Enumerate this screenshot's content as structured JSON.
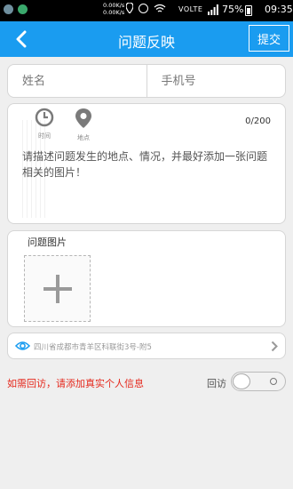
{
  "status_bar": {
    "net_speed_up": "0.00K/s",
    "net_speed_down": "0.00K/s",
    "carrier": "VOLTE",
    "battery": "75%",
    "time": "09:35",
    "icons": [
      "sim-icon",
      "app-icon",
      "location-icon",
      "alarm-icon",
      "wifi-icon",
      "signal-icon",
      "battery-icon"
    ]
  },
  "header": {
    "title": "问题反映",
    "submit_label": "提交",
    "color": "#1a9cf0"
  },
  "form": {
    "name_placeholder": "姓名",
    "phone_placeholder": "手机号",
    "tools": [
      {
        "label": "时间",
        "icon": "clock-icon"
      },
      {
        "label": "地点",
        "icon": "location-pin-icon"
      }
    ],
    "counter": "0/200",
    "description_placeholder": "请描述问题发生的地点、情况，并最好添加一张问题相关的图片！",
    "photos_title": "问题图片",
    "address": "四川省成都市青羊区科联街3号-附5"
  },
  "footer": {
    "hint": "如需回访，请添加真实个人信息",
    "revisit_label": "回访",
    "revisit_enabled": false,
    "hint_color": "#e5281c"
  }
}
